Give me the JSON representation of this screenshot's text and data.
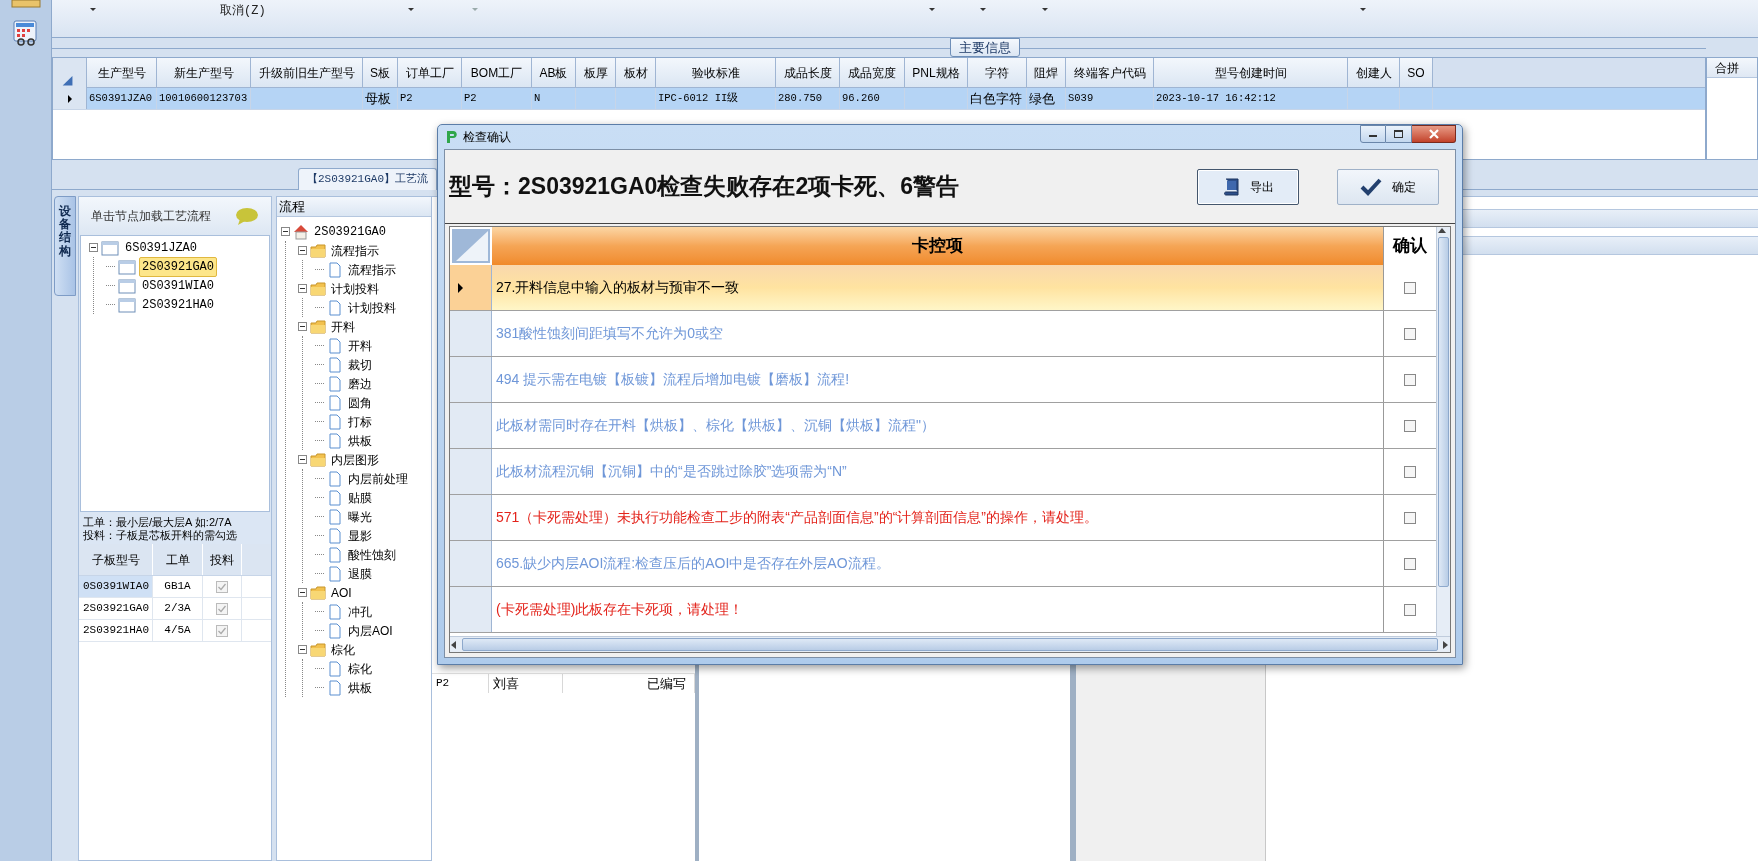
{
  "toolbar": {
    "items": [
      {
        "label": "取消(Z)"
      }
    ]
  },
  "main_info": {
    "title": "主要信息",
    "columns": [
      "生产型号",
      "新生产型号",
      "升级前旧生产型号",
      "S板",
      "订单工厂",
      "BOM工厂",
      "AB板",
      "板厚",
      "板材",
      "验收标准",
      "成品长度",
      "成品宽度",
      "PNL规格",
      "字符",
      "阻焊",
      "终端客户代码",
      "型号创建时间",
      "创建人",
      "SO"
    ],
    "rows": [
      {
        "selected": true,
        "cells": [
          "6S0391JZA0",
          "10010600123703",
          null,
          "母板",
          "P2",
          "P2",
          "N",
          null,
          null,
          "IPC-6012 II级",
          "280.750",
          "96.260",
          null,
          "白色字符",
          "绿色",
          "S039",
          "2023-10-17 16:42:12",
          null,
          null
        ]
      }
    ]
  },
  "right_panel": {
    "title": "合拼"
  },
  "process_tab": {
    "title": "【2S03921GA0】工艺流"
  },
  "side_tab": {
    "label": "设备结构"
  },
  "structure": {
    "header": "单击节点加载工艺流程",
    "tree": [
      {
        "label": "6S0391JZA0",
        "selected": false,
        "children": [
          {
            "label": "2S03921GA0",
            "selected": true
          },
          {
            "label": "0S0391WIA0",
            "selected": false
          },
          {
            "label": "2S03921HA0",
            "selected": false
          }
        ]
      }
    ],
    "notes": [
      "工单：最小层/最大层A 如:2/7A",
      "投料：子板是芯板开料的需勾选"
    ],
    "columns": [
      "子板型号",
      "工单",
      "投料"
    ],
    "rows": [
      {
        "cells": [
          "0S0391WIA0",
          "GB1A"
        ],
        "checked": true,
        "selected": true
      },
      {
        "cells": [
          "2S03921GA0",
          "2/3A"
        ],
        "checked": true,
        "selected": false
      },
      {
        "cells": [
          "2S03921HA0",
          "4/5A"
        ],
        "checked": true,
        "selected": false
      }
    ]
  },
  "flow": {
    "header": "流程",
    "tree": [
      {
        "label": "2S03921GA0",
        "kind": "root",
        "children": [
          {
            "label": "流程指示",
            "kind": "folder",
            "children": [
              {
                "label": "流程指示",
                "kind": "step"
              }
            ]
          },
          {
            "label": "计划投料",
            "kind": "folder",
            "children": [
              {
                "label": "计划投料",
                "kind": "step"
              }
            ]
          },
          {
            "label": "开料",
            "kind": "folder",
            "children": [
              {
                "label": "开料",
                "kind": "step"
              },
              {
                "label": "裁切",
                "kind": "step"
              },
              {
                "label": "磨边",
                "kind": "step"
              },
              {
                "label": "圆角",
                "kind": "step"
              },
              {
                "label": "打标",
                "kind": "step"
              },
              {
                "label": "烘板",
                "kind": "step"
              }
            ]
          },
          {
            "label": "内层图形",
            "kind": "folder",
            "children": [
              {
                "label": "内层前处理",
                "kind": "step"
              },
              {
                "label": "贴膜",
                "kind": "step"
              },
              {
                "label": "曝光",
                "kind": "step"
              },
              {
                "label": "显影",
                "kind": "step"
              },
              {
                "label": "酸性蚀刻",
                "kind": "step"
              },
              {
                "label": "退膜",
                "kind": "step"
              }
            ]
          },
          {
            "label": "AOI",
            "kind": "folder",
            "children": [
              {
                "label": "冲孔",
                "kind": "step"
              },
              {
                "label": "内层AOI",
                "kind": "step"
              }
            ]
          },
          {
            "label": "棕化",
            "kind": "folder",
            "children": [
              {
                "label": "棕化",
                "kind": "step"
              },
              {
                "label": "烘板",
                "kind": "step"
              }
            ]
          }
        ]
      }
    ]
  },
  "flow_table": {
    "rows": [
      {
        "cells": [
          "P2",
          "刘喜",
          "已编写"
        ]
      }
    ]
  },
  "dialog": {
    "title": "检查确认",
    "heading": "型号：2S03921GA0检查失败存在2项卡死、6警告",
    "buttons": [
      {
        "label": "导出",
        "kind": "export"
      },
      {
        "label": "确定",
        "kind": "ok"
      }
    ],
    "columns": [
      "卡控项",
      "确认"
    ],
    "rows": [
      {
        "text": "27.开料信息中输入的板材与预审不一致",
        "kind": "warning",
        "selected": true,
        "checked": false
      },
      {
        "text": "381酸性蚀刻间距填写不允许为0或空",
        "kind": "warning",
        "selected": false,
        "checked": false
      },
      {
        "text": "494 提示需在电镀【板镀】流程后增加电镀【磨板】流程!",
        "kind": "warning",
        "selected": false,
        "checked": false
      },
      {
        "text": "此板材需同时存在开料【烘板】、棕化【烘板】、沉铜【烘板】流程\"）",
        "kind": "warning",
        "selected": false,
        "checked": false
      },
      {
        "text": "此板材流程沉铜【沉铜】中的“是否跳过除胶”选项需为“N”",
        "kind": "warning",
        "selected": false,
        "checked": false
      },
      {
        "text": "571（卡死需处理）未执行功能检查工步的附表“产品剖面信息”的“计算剖面信息”的操作，请处理。",
        "kind": "block",
        "selected": false,
        "checked": false
      },
      {
        "text": "665.缺少内层AOI流程:检查压后的AOI中是否存在外层AO流程。",
        "kind": "warning",
        "selected": false,
        "checked": false
      },
      {
        "text": "(卡死需处理)此板存在卡死项，请处理！",
        "kind": "block",
        "selected": false,
        "checked": false
      }
    ]
  }
}
